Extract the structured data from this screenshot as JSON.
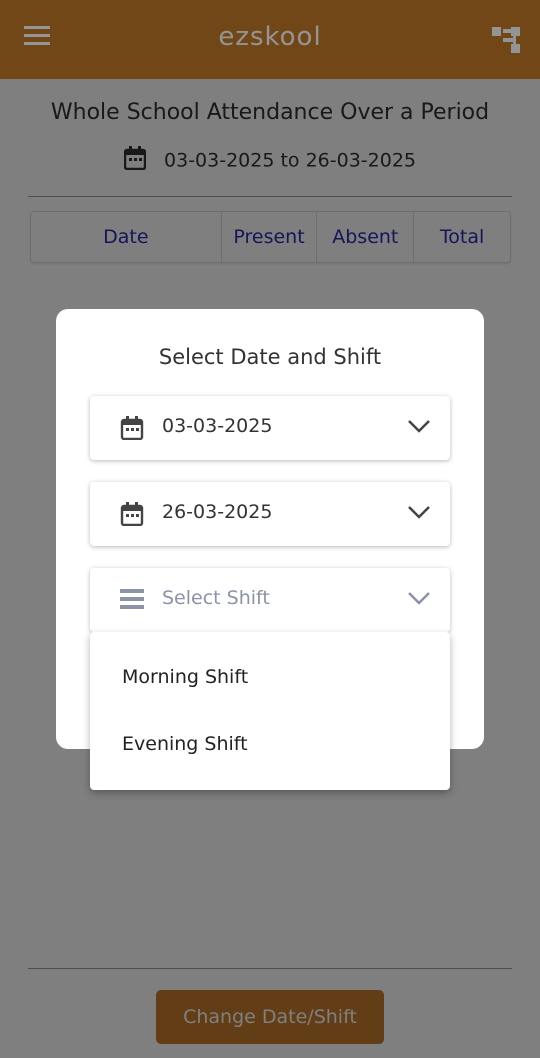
{
  "appbar": {
    "title": "ezskool",
    "menu_icon": "hamburger-menu-icon",
    "right_icon": "hierarchy-tree-icon",
    "color": "#c47a2a"
  },
  "main": {
    "heading": "Whole School Attendance Over a Period",
    "date_range": "03-03-2025 to 26-03-2025",
    "table": {
      "columns": [
        "Date",
        "Present",
        "Absent",
        "Total"
      ]
    },
    "change_button": "Change Date/Shift"
  },
  "dialog": {
    "title": "Select Date and Shift",
    "start_date": "03-03-2025",
    "end_date": "26-03-2025",
    "shift_placeholder": "Select Shift",
    "shift_options": [
      "Morning Shift",
      "Evening Shift"
    ]
  }
}
